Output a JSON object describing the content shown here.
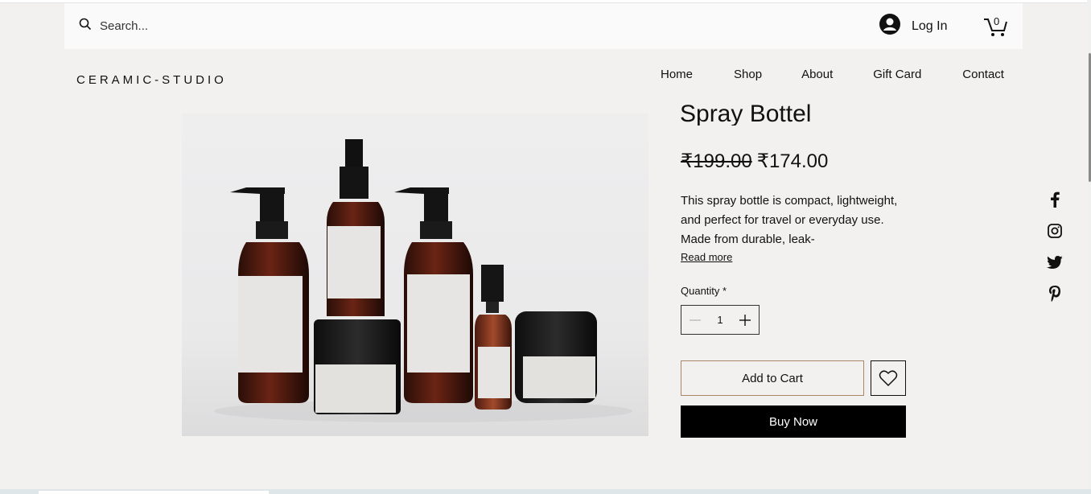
{
  "header": {
    "search_placeholder": "Search...",
    "login_label": "Log In",
    "cart_count": "0"
  },
  "brand": {
    "name": "CERAMIC-STUDIO"
  },
  "nav": {
    "items": [
      {
        "label": "Home"
      },
      {
        "label": "Shop"
      },
      {
        "label": "About"
      },
      {
        "label": "Gift Card"
      },
      {
        "label": "Contact"
      }
    ]
  },
  "product": {
    "title": "Spray Bottel",
    "price_old": "₹199.00",
    "price_new": "₹174.00",
    "description": "This spray bottle is compact, lightweight, and perfect for travel or everyday use. Made from durable, leak-",
    "read_more": "Read more",
    "quantity_label": "Quantity *",
    "quantity_value": "1",
    "add_to_cart": "Add to Cart",
    "buy_now": "Buy Now"
  },
  "social": {
    "icons": [
      "facebook-icon",
      "instagram-icon",
      "twitter-icon",
      "pinterest-icon"
    ]
  },
  "colors": {
    "page_bg": "#f2f1ef",
    "topbar_bg": "#fafafa",
    "add_cart_border": "#a8876a",
    "buy_now_bg": "#000000"
  }
}
